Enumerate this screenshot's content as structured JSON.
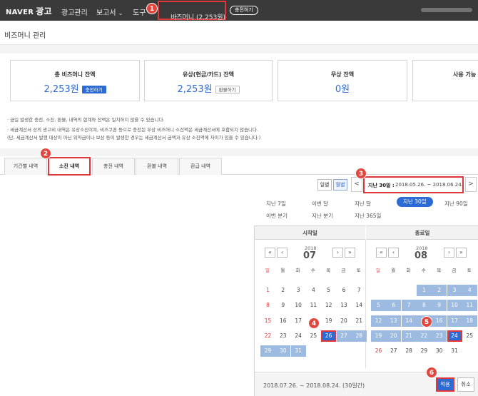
{
  "nav": {
    "logo": "NAVER",
    "logo_suffix": "광고",
    "items": [
      "광고관리",
      "보고서",
      "도구"
    ],
    "biz_money": "비즈머니 (2,253원)",
    "charge": "충전하기"
  },
  "page": {
    "title": "비즈머니 관리"
  },
  "summary": {
    "total": {
      "label": "총 비즈머니 잔액",
      "value": "2,253원",
      "button": "충전하기"
    },
    "paid": {
      "label": "유상(현금/카드) 잔액",
      "value": "2,253원",
      "button": "환불하기"
    },
    "free": {
      "label": "무상 잔액",
      "value": "0원"
    },
    "usable": {
      "label": "사용 가능"
    }
  },
  "notes": [
    "· 금일 발생한 충전, 소진, 환불, 내역의 합계와 잔액은 일치하지 않을 수 있습니다.",
    "· 세금계산서 상의 광고비 내역은 유상소진이며, 비즈쿠폰 등으로 충전된 무상 비즈머니 소진액은 세금계산서에 포함되지 않습니다.",
    "(단, 세금계산서 발행 대상이 아닌 위약금이나 보상 등이 발생한 경우는 세금계산서 금액과 유상 소진액에 차이가 있을 수 있습니다.)"
  ],
  "tabs": [
    "기간별 내역",
    "소진 내역",
    "충전 내역",
    "환불 내역",
    "환급 내역"
  ],
  "toolbar": {
    "daily": "일별",
    "monthly": "월별",
    "prev": "<",
    "next": ">",
    "period_label": "지난 30일 :",
    "period_range": "2018.05.26. ~ 2018.06.24."
  },
  "presets": [
    "지난 7일",
    "이번 달",
    "지난 달",
    "지난 30일",
    "지난 90일",
    "이번 분기",
    "지난 분기",
    "지난 365일"
  ],
  "calendar": {
    "start_label": "시작일",
    "end_label": "종료일",
    "left": {
      "year": "2018",
      "month": "07"
    },
    "right": {
      "year": "2018",
      "month": "08"
    },
    "weekdays": [
      "일",
      "월",
      "화",
      "수",
      "목",
      "금",
      "토"
    ],
    "nav": {
      "first": "«",
      "prev": "‹",
      "next": "›",
      "last": "»"
    },
    "left_days": [
      "1",
      "2",
      "3",
      "4",
      "5",
      "6",
      "7",
      "8",
      "9",
      "10",
      "11",
      "12",
      "13",
      "14",
      "15",
      "16",
      "17",
      "18",
      "19",
      "20",
      "21",
      "22",
      "23",
      "24",
      "25",
      "26",
      "27",
      "28",
      "29",
      "30",
      "31"
    ],
    "right_days": [
      "1",
      "2",
      "3",
      "4",
      "5",
      "6",
      "7",
      "8",
      "9",
      "10",
      "11",
      "12",
      "13",
      "14",
      "15",
      "16",
      "17",
      "18",
      "19",
      "20",
      "21",
      "22",
      "23",
      "24",
      "25",
      "26",
      "27",
      "28",
      "29",
      "30",
      "31"
    ],
    "selection_text": "2018.07.26. ~ 2018.08.24. (30일간)",
    "apply": "적용",
    "cancel": "취소"
  },
  "badges": [
    "1",
    "2",
    "3",
    "4",
    "5",
    "6"
  ],
  "colors": {
    "accent": "#2d6bd4",
    "highlight": "#e0383a",
    "range": "#9dbae0"
  }
}
